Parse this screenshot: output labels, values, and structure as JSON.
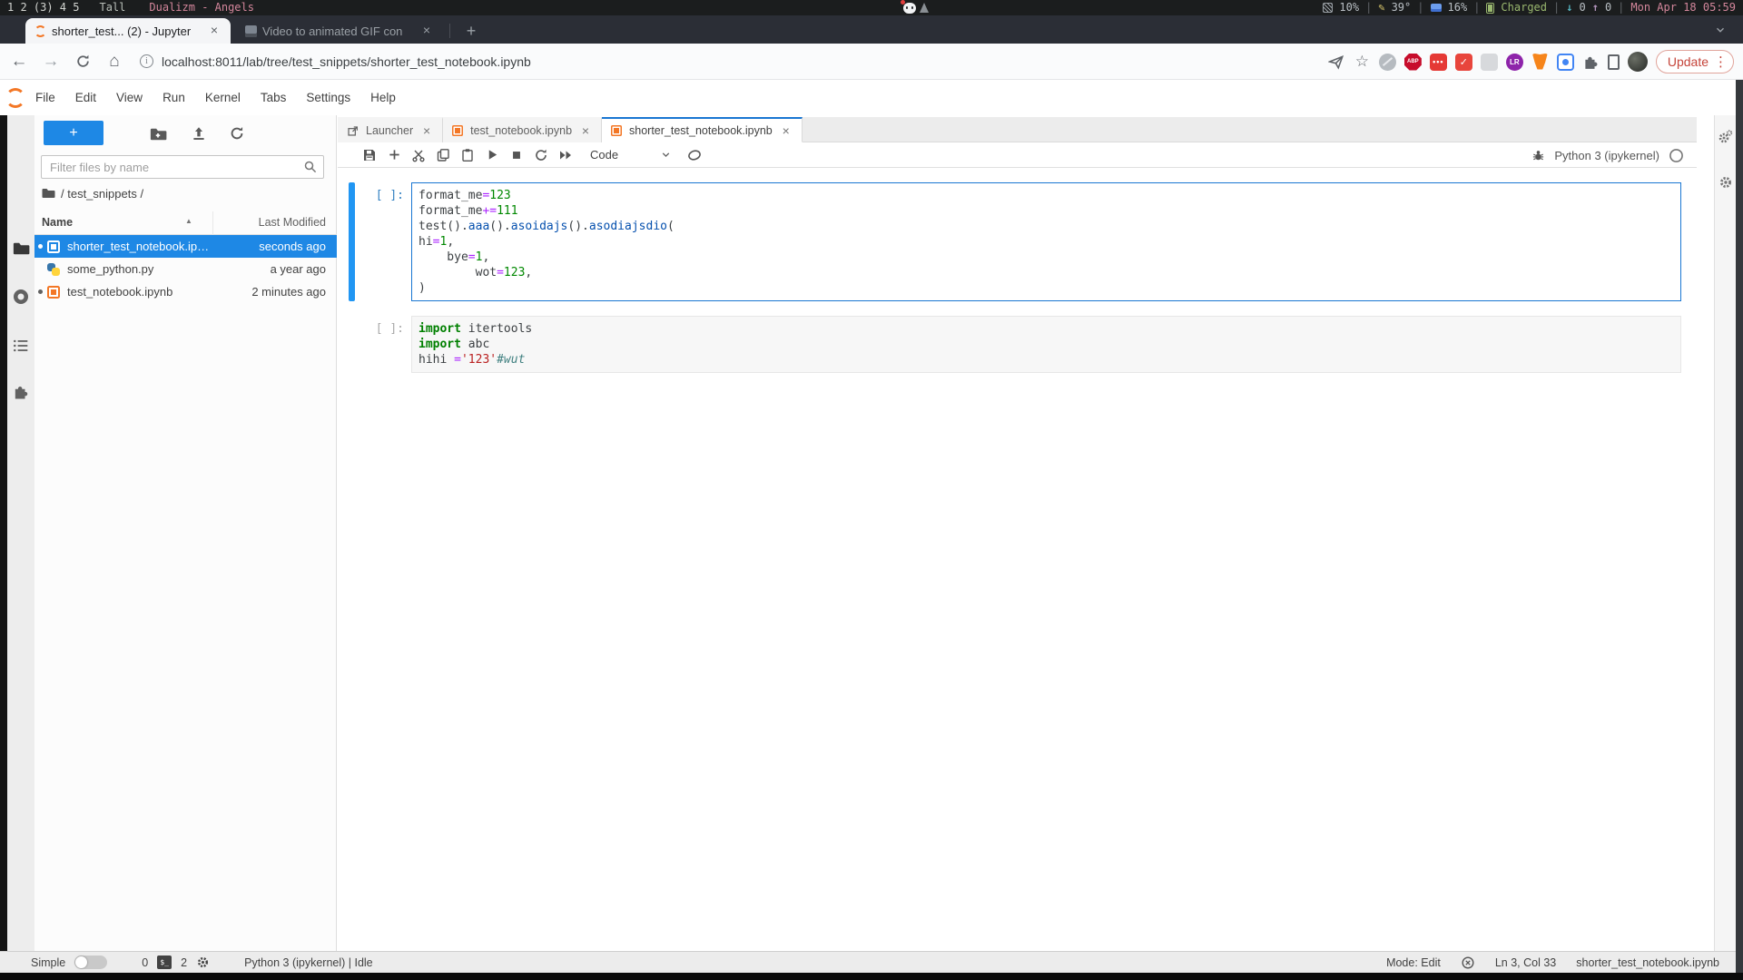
{
  "icons": {
    "close": "×",
    "kebab": "⋮",
    "back": "←",
    "forward": "→",
    "home": "⌂",
    "plus": "+",
    "star": "☆",
    "info": "i",
    "pencil": "✎",
    "down_arrow": "↓",
    "up_arrow": "↑",
    "sort_caret": "▲",
    "dots": "•••",
    "check": "✓",
    "terminal_prompt": "$_",
    "abp": "ABP",
    "lr": "LR"
  },
  "sysbar": {
    "workspaces": "1 2 (3) 4 5",
    "layout_name": "Tall",
    "window_title": "Dualizm - Angels",
    "cpu": "10%",
    "temp": "39°",
    "mem": "16%",
    "battery_status": "Charged",
    "net_down": "0",
    "net_up": "0",
    "clock": "Mon Apr 18 05:59",
    "sep": "|"
  },
  "browser": {
    "tab1": {
      "title": "shorter_test... (2) - Jupyter"
    },
    "tab2": {
      "title": "Video to animated GIF con"
    },
    "url": "localhost:8011/lab/tree/test_snippets/shorter_test_notebook.ipynb",
    "update_label": "Update"
  },
  "menubar": {
    "items": [
      "File",
      "Edit",
      "View",
      "Run",
      "Kernel",
      "Tabs",
      "Settings",
      "Help"
    ]
  },
  "filebrowser": {
    "filter_placeholder": "Filter files by name",
    "breadcrumb": "/ test_snippets /",
    "columns": {
      "name": "Name",
      "modified": "Last Modified"
    },
    "files": [
      {
        "name": "shorter_test_notebook.ip…",
        "modified": "seconds ago"
      },
      {
        "name": "some_python.py",
        "modified": "a year ago"
      },
      {
        "name": "test_notebook.ipynb",
        "modified": "2 minutes ago"
      }
    ]
  },
  "dock": {
    "tabs": [
      {
        "label": "Launcher"
      },
      {
        "label": "test_notebook.ipynb"
      },
      {
        "label": "shorter_test_notebook.ipynb"
      }
    ]
  },
  "toolbar": {
    "cell_type": "Code",
    "kernel_name": "Python 3 (ipykernel)"
  },
  "cells": [
    {
      "prompt": "[ ]:",
      "lines": [
        [
          {
            "t": "format_me"
          },
          {
            "t": "=",
            "c": "op"
          },
          {
            "t": "123",
            "c": "num"
          }
        ],
        [
          {
            "t": "format_me"
          },
          {
            "t": "+=",
            "c": "op"
          },
          {
            "t": "111",
            "c": "num"
          }
        ],
        [
          {
            "t": "test()."
          },
          {
            "t": "aaa",
            "c": "prop"
          },
          {
            "t": "()."
          },
          {
            "t": "asoidajs",
            "c": "prop"
          },
          {
            "t": "()."
          },
          {
            "t": "asodiajsdio",
            "c": "prop"
          },
          {
            "t": "("
          }
        ],
        [
          {
            "t": "hi"
          },
          {
            "t": "=",
            "c": "op"
          },
          {
            "t": "1",
            "c": "num"
          },
          {
            "t": ","
          }
        ],
        [
          {
            "t": "    bye"
          },
          {
            "t": "=",
            "c": "op"
          },
          {
            "t": "1",
            "c": "num"
          },
          {
            "t": ","
          }
        ],
        [
          {
            "t": "        wot"
          },
          {
            "t": "=",
            "c": "op"
          },
          {
            "t": "123",
            "c": "num"
          },
          {
            "t": ","
          }
        ],
        [
          {
            "t": ")"
          }
        ]
      ]
    },
    {
      "prompt": "[ ]:",
      "lines": [
        [
          {
            "t": "import",
            "c": "kw"
          },
          {
            "t": " itertools"
          }
        ],
        [
          {
            "t": "import",
            "c": "kw"
          },
          {
            "t": " abc"
          }
        ],
        [
          {
            "t": "hihi "
          },
          {
            "t": "=",
            "c": "op"
          },
          {
            "t": "'123'",
            "c": "str"
          },
          {
            "t": "#wut",
            "c": "com"
          }
        ]
      ]
    }
  ],
  "statusbar": {
    "simple_label": "Simple",
    "terminals_count": "0",
    "kernels_count": "2",
    "kernel_status": "Python 3 (ipykernel) | Idle",
    "mode": "Mode: Edit",
    "cursor": "Ln 3, Col 33",
    "filename": "shorter_test_notebook.ipynb"
  }
}
